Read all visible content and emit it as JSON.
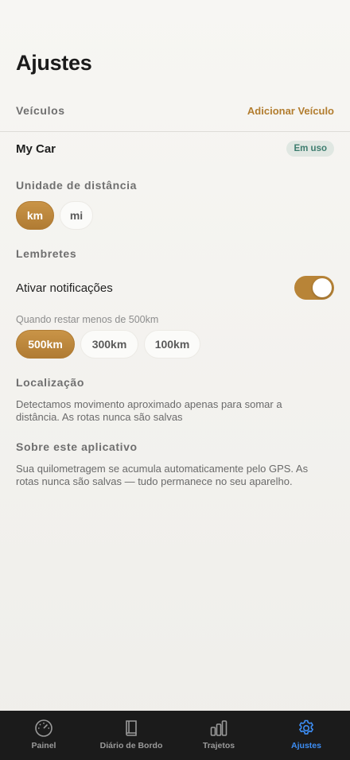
{
  "header": {
    "title": "Ajustes"
  },
  "vehicles": {
    "label": "Veículos",
    "add_label": "Adicionar Veículo",
    "items": [
      {
        "name": "My Car",
        "badge": "Em uso"
      }
    ]
  },
  "distance_unit": {
    "label": "Unidade de distância",
    "options": [
      "km",
      "mi"
    ],
    "selected": "km"
  },
  "reminders": {
    "label": "Lembretes",
    "notifications_label": "Ativar notificações",
    "notifications_enabled": true,
    "threshold_hint": "Quando restar menos de 500km",
    "options": [
      "500km",
      "300km",
      "100km"
    ],
    "selected": "500km"
  },
  "location": {
    "label": "Localização",
    "text": "Detectamos movimento aproximado apenas para somar a distância. As rotas nunca são salvas"
  },
  "about": {
    "label": "Sobre este aplicativo",
    "text": "Sua quilometragem se acumula automaticamente pelo GPS. As rotas nunca são salvas — tudo permanece no seu aparelho."
  },
  "tabbar": {
    "tabs": [
      {
        "label": "Painel",
        "icon": "gauge-icon"
      },
      {
        "label": "Diário de Bordo",
        "icon": "book-icon"
      },
      {
        "label": "Trajetos",
        "icon": "bars-icon"
      },
      {
        "label": "Ajustes",
        "icon": "gear-icon"
      }
    ],
    "active": "Ajustes"
  },
  "colors": {
    "accent": "#b88437",
    "active_tab": "#3d8ef5",
    "badge_text": "#3e7d6f",
    "tabbar_bg": "#1b1b1b"
  }
}
